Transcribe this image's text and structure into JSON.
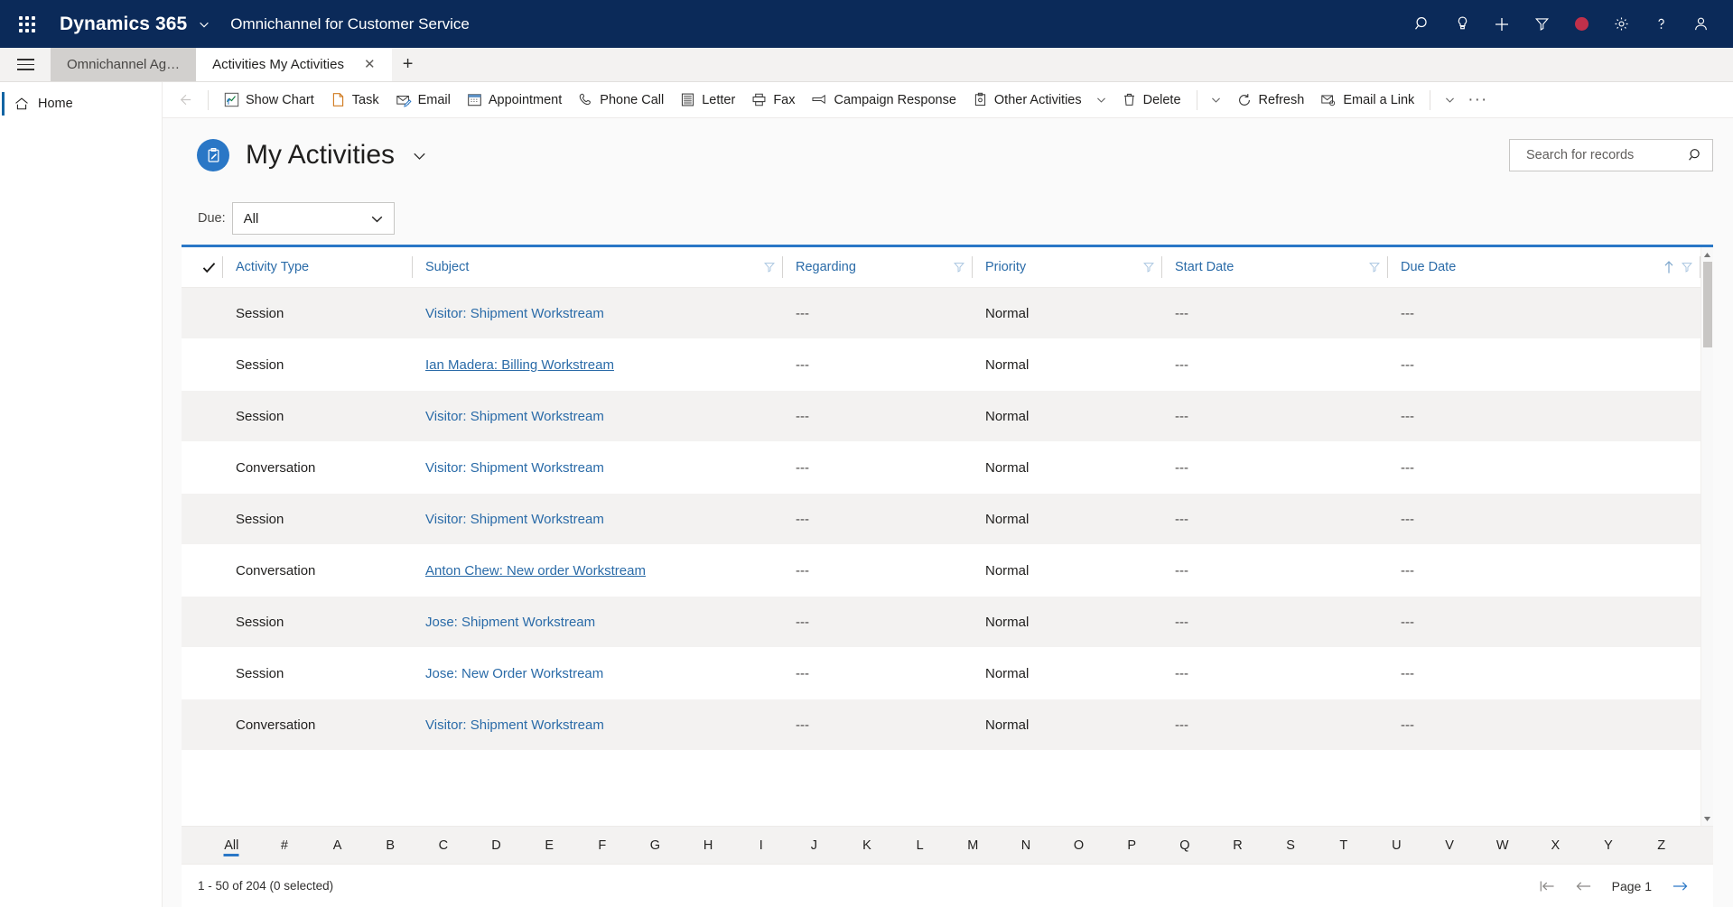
{
  "header": {
    "waffle_icon": "app-launcher-icon",
    "brand": "Dynamics 365",
    "brand_chevron_icon": "chevron-down-icon",
    "app_name": "Omnichannel for Customer Service",
    "right_icons": [
      {
        "name": "search-icon",
        "label": "Search"
      },
      {
        "name": "lightbulb-icon",
        "label": "Insights"
      },
      {
        "name": "plus-icon",
        "label": "New"
      },
      {
        "name": "filter-icon",
        "label": "Filter"
      },
      {
        "name": "presence-status-dot",
        "label": "Presence",
        "color": "#c0304a"
      },
      {
        "name": "gear-icon",
        "label": "Settings"
      },
      {
        "name": "question-icon",
        "label": "Help"
      },
      {
        "name": "person-icon",
        "label": "Account manager"
      }
    ]
  },
  "tabstrip": {
    "hamburger_icon": "hamburger-menu-icon",
    "tabs": [
      {
        "label": "Omnichannel Ag…",
        "active": false,
        "closable": false
      },
      {
        "label": "Activities My Activities",
        "active": true,
        "closable": true
      }
    ],
    "close_glyph": "✕",
    "add_tab_glyph": "+"
  },
  "sidebar": {
    "items": [
      {
        "label": "Home",
        "icon": "home-icon",
        "selected": true
      }
    ]
  },
  "commandbar": {
    "back_icon": "arrow-left-icon",
    "buttons": [
      {
        "label": "Show Chart",
        "icon": "chart-icon"
      },
      {
        "label": "Task",
        "icon": "task-icon"
      },
      {
        "label": "Email",
        "icon": "email-icon"
      },
      {
        "label": "Appointment",
        "icon": "calendar-icon"
      },
      {
        "label": "Phone Call",
        "icon": "phone-icon"
      },
      {
        "label": "Letter",
        "icon": "letter-icon"
      },
      {
        "label": "Fax",
        "icon": "fax-icon"
      },
      {
        "label": "Campaign Response",
        "icon": "campaign-response-icon"
      },
      {
        "label": "Other Activities",
        "icon": "other-activities-icon",
        "caret": true
      },
      {
        "label": "Delete",
        "icon": "trash-icon",
        "separator_after": true,
        "caret_after": true
      },
      {
        "label": "Refresh",
        "icon": "refresh-icon"
      },
      {
        "label": "Email a Link",
        "icon": "email-link-icon",
        "separator_after": true,
        "caret_after": true
      }
    ],
    "overflow_glyph": "···"
  },
  "view": {
    "entity_icon": "activity-clipboard-icon",
    "entity_icon_color": "#2a77c6",
    "title": "My Activities",
    "title_chevron_icon": "chevron-down-icon",
    "search": {
      "placeholder": "Search for records",
      "value": "",
      "icon": "search-icon"
    },
    "filter": {
      "label": "Due:",
      "value": "All",
      "chevron_icon": "chevron-down-icon"
    }
  },
  "grid": {
    "select_all_icon": "checkmark-icon",
    "columns": [
      {
        "label": "Activity Type",
        "filter": false,
        "sorted": false
      },
      {
        "label": "Subject",
        "filter": true,
        "sorted": false
      },
      {
        "label": "Regarding",
        "filter": true,
        "sorted": false
      },
      {
        "label": "Priority",
        "filter": true,
        "sorted": false
      },
      {
        "label": "Start Date",
        "filter": true,
        "sorted": false
      },
      {
        "label": "Due Date",
        "filter": true,
        "sorted": true,
        "sort_icon": "arrow-up-icon"
      }
    ],
    "rows": [
      {
        "activity_type": "Session",
        "subject": "Visitor: Shipment Workstream",
        "regarding": "---",
        "priority": "Normal",
        "start_date": "---",
        "due_date": "---",
        "hovered": false
      },
      {
        "activity_type": "Session",
        "subject": "Ian Madera: Billing Workstream",
        "regarding": "---",
        "priority": "Normal",
        "start_date": "---",
        "due_date": "---",
        "hovered": true
      },
      {
        "activity_type": "Session",
        "subject": "Visitor: Shipment Workstream",
        "regarding": "---",
        "priority": "Normal",
        "start_date": "---",
        "due_date": "---",
        "hovered": false
      },
      {
        "activity_type": "Conversation",
        "subject": "Visitor: Shipment Workstream",
        "regarding": "---",
        "priority": "Normal",
        "start_date": "---",
        "due_date": "---",
        "hovered": false
      },
      {
        "activity_type": "Session",
        "subject": "Visitor: Shipment Workstream",
        "regarding": "---",
        "priority": "Normal",
        "start_date": "---",
        "due_date": "---",
        "hovered": false
      },
      {
        "activity_type": "Conversation",
        "subject": "Anton Chew: New order Workstream",
        "regarding": "---",
        "priority": "Normal",
        "start_date": "---",
        "due_date": "---",
        "hovered": true
      },
      {
        "activity_type": "Session",
        "subject": "Jose: Shipment Workstream",
        "regarding": "---",
        "priority": "Normal",
        "start_date": "---",
        "due_date": "---",
        "hovered": false
      },
      {
        "activity_type": "Session",
        "subject": "Jose: New Order Workstream",
        "regarding": "---",
        "priority": "Normal",
        "start_date": "---",
        "due_date": "---",
        "hovered": false
      },
      {
        "activity_type": "Conversation",
        "subject": "Visitor: Shipment Workstream",
        "regarding": "---",
        "priority": "Normal",
        "start_date": "---",
        "due_date": "---",
        "hovered": false
      }
    ],
    "scrollbar": {
      "up_icon": "scroll-up-icon",
      "down_icon": "scroll-down-icon"
    }
  },
  "alpha_filter": {
    "active": "All",
    "items": [
      "All",
      "#",
      "A",
      "B",
      "C",
      "D",
      "E",
      "F",
      "G",
      "H",
      "I",
      "J",
      "K",
      "L",
      "M",
      "N",
      "O",
      "P",
      "Q",
      "R",
      "S",
      "T",
      "U",
      "V",
      "W",
      "X",
      "Y",
      "Z"
    ]
  },
  "footer": {
    "record_count": "1 - 50 of 204 (0 selected)",
    "first_page_icon": "first-page-icon",
    "prev_page_icon": "previous-page-icon",
    "page_label": "Page 1",
    "next_page_icon": "next-page-icon"
  }
}
